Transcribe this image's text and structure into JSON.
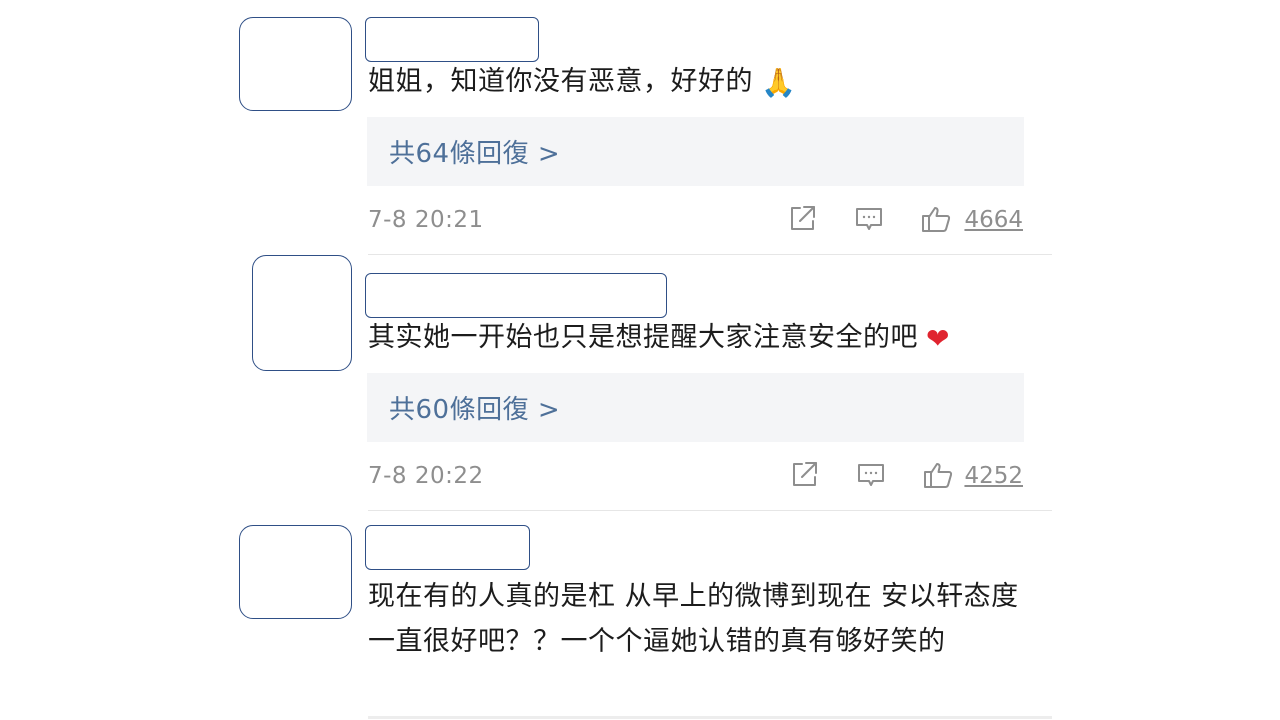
{
  "comments": [
    {
      "text": "姐姐，知道你没有恶意，好好的",
      "emoji": "🙏",
      "replies_label": "共64條回復 >",
      "timestamp": "7-8 20:21",
      "likes": "4664"
    },
    {
      "text": "其实她一开始也只是想提醒大家注意安全的吧",
      "emoji": "❤",
      "replies_label": "共60條回復 >",
      "timestamp": "7-8 20:22",
      "likes": "4252"
    },
    {
      "text": "现在有的人真的是杠 从早上的微博到现在 安以轩态度一直很好吧？？一个个逼她认错的真有够好笑的",
      "emoji": "",
      "replies_label": "",
      "timestamp": "",
      "likes": ""
    }
  ],
  "icons": {
    "share": "share-icon",
    "comment": "comment-icon",
    "like": "thumbs-up-icon"
  },
  "colors": {
    "link": "#4e7099",
    "muted": "#8e8e8e",
    "reply_bg": "#f4f5f7",
    "placeholder_border": "#2f4f86"
  }
}
